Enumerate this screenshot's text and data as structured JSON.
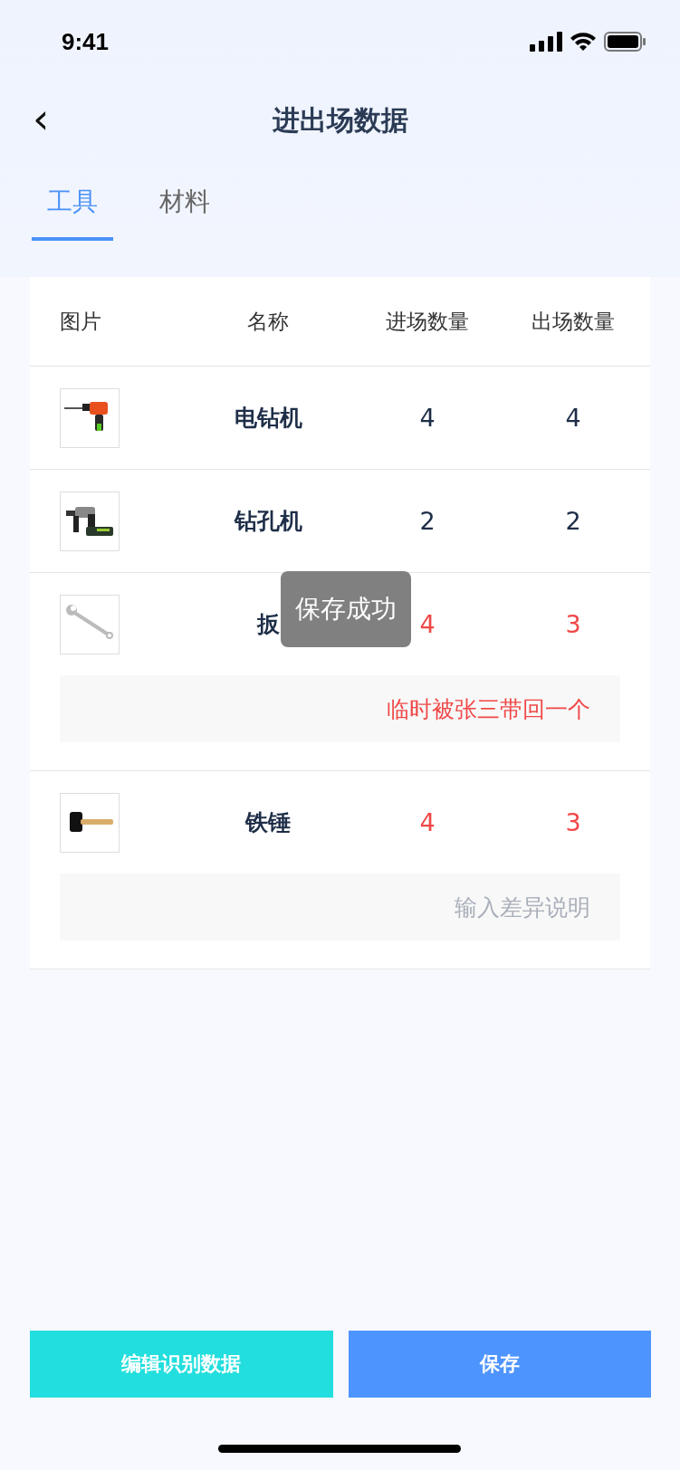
{
  "status_bar": {
    "time": "9:41"
  },
  "header": {
    "title": "进出场数据",
    "back_icon": "‹"
  },
  "tabs": [
    {
      "label": "工具",
      "selected": true
    },
    {
      "label": "材料",
      "selected": false
    }
  ],
  "table": {
    "columns": [
      "图片",
      "名称",
      "进场数量",
      "出场数量"
    ],
    "rows": [
      {
        "name": "电钻机",
        "in": "4",
        "out": "4",
        "mismatch": false
      },
      {
        "name": "钻孔机",
        "in": "2",
        "out": "2",
        "mismatch": false
      },
      {
        "name": "扳",
        "in": "4",
        "out": "3",
        "mismatch": true,
        "note": {
          "value": "临时被张三带回一个"
        }
      },
      {
        "name": "铁锤",
        "in": "4",
        "out": "3",
        "mismatch": true,
        "note": {
          "placeholder": "输入差异说明"
        }
      }
    ]
  },
  "toast": "保存成功",
  "buttons": [
    {
      "label": "编辑识别数据",
      "kind": "secondary"
    },
    {
      "label": "保存",
      "kind": "primary"
    }
  ]
}
